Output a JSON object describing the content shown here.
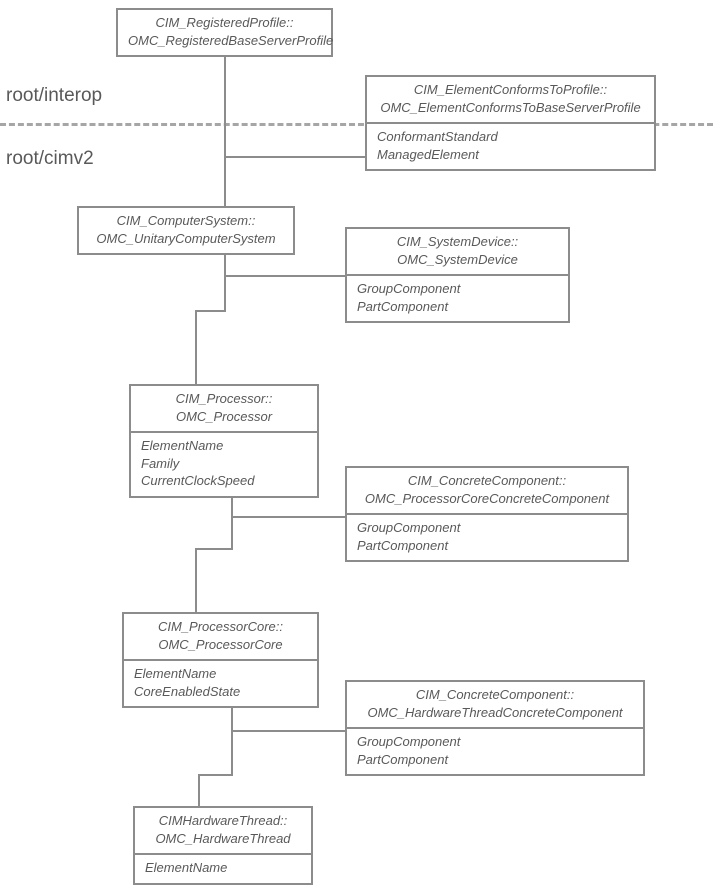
{
  "namespaces": {
    "interop": "root/interop",
    "cimv2": "root/cimv2"
  },
  "boxes": {
    "registeredProfile": {
      "line1": "CIM_RegisteredProfile::",
      "line2": "OMC_RegisteredBaseServerProfile"
    },
    "elementConforms": {
      "line1": "CIM_ElementConformsToProfile::",
      "line2": "OMC_ElementConformsToBaseServerProfile",
      "attr1": "ConformantStandard",
      "attr2": "ManagedElement"
    },
    "computerSystem": {
      "line1": "CIM_ComputerSystem::",
      "line2": "OMC_UnitaryComputerSystem"
    },
    "systemDevice": {
      "line1": "CIM_SystemDevice::",
      "line2": "OMC_SystemDevice",
      "attr1": "GroupComponent",
      "attr2": "PartComponent"
    },
    "processor": {
      "line1": "CIM_Processor::",
      "line2": "OMC_Processor",
      "attr1": "ElementName",
      "attr2": "Family",
      "attr3": "CurrentClockSpeed"
    },
    "processorCoreComp": {
      "line1": "CIM_ConcreteComponent::",
      "line2": "OMC_ProcessorCoreConcreteComponent",
      "attr1": "GroupComponent",
      "attr2": "PartComponent"
    },
    "processorCore": {
      "line1": "CIM_ProcessorCore::",
      "line2": "OMC_ProcessorCore",
      "attr1": "ElementName",
      "attr2": "CoreEnabledState"
    },
    "hwThreadComp": {
      "line1": "CIM_ConcreteComponent::",
      "line2": "OMC_HardwareThreadConcreteComponent",
      "attr1": "GroupComponent",
      "attr2": "PartComponent"
    },
    "hwThread": {
      "line1": "CIMHardwareThread::",
      "line2": "OMC_HardwareThread",
      "attr1": "ElementName"
    }
  }
}
